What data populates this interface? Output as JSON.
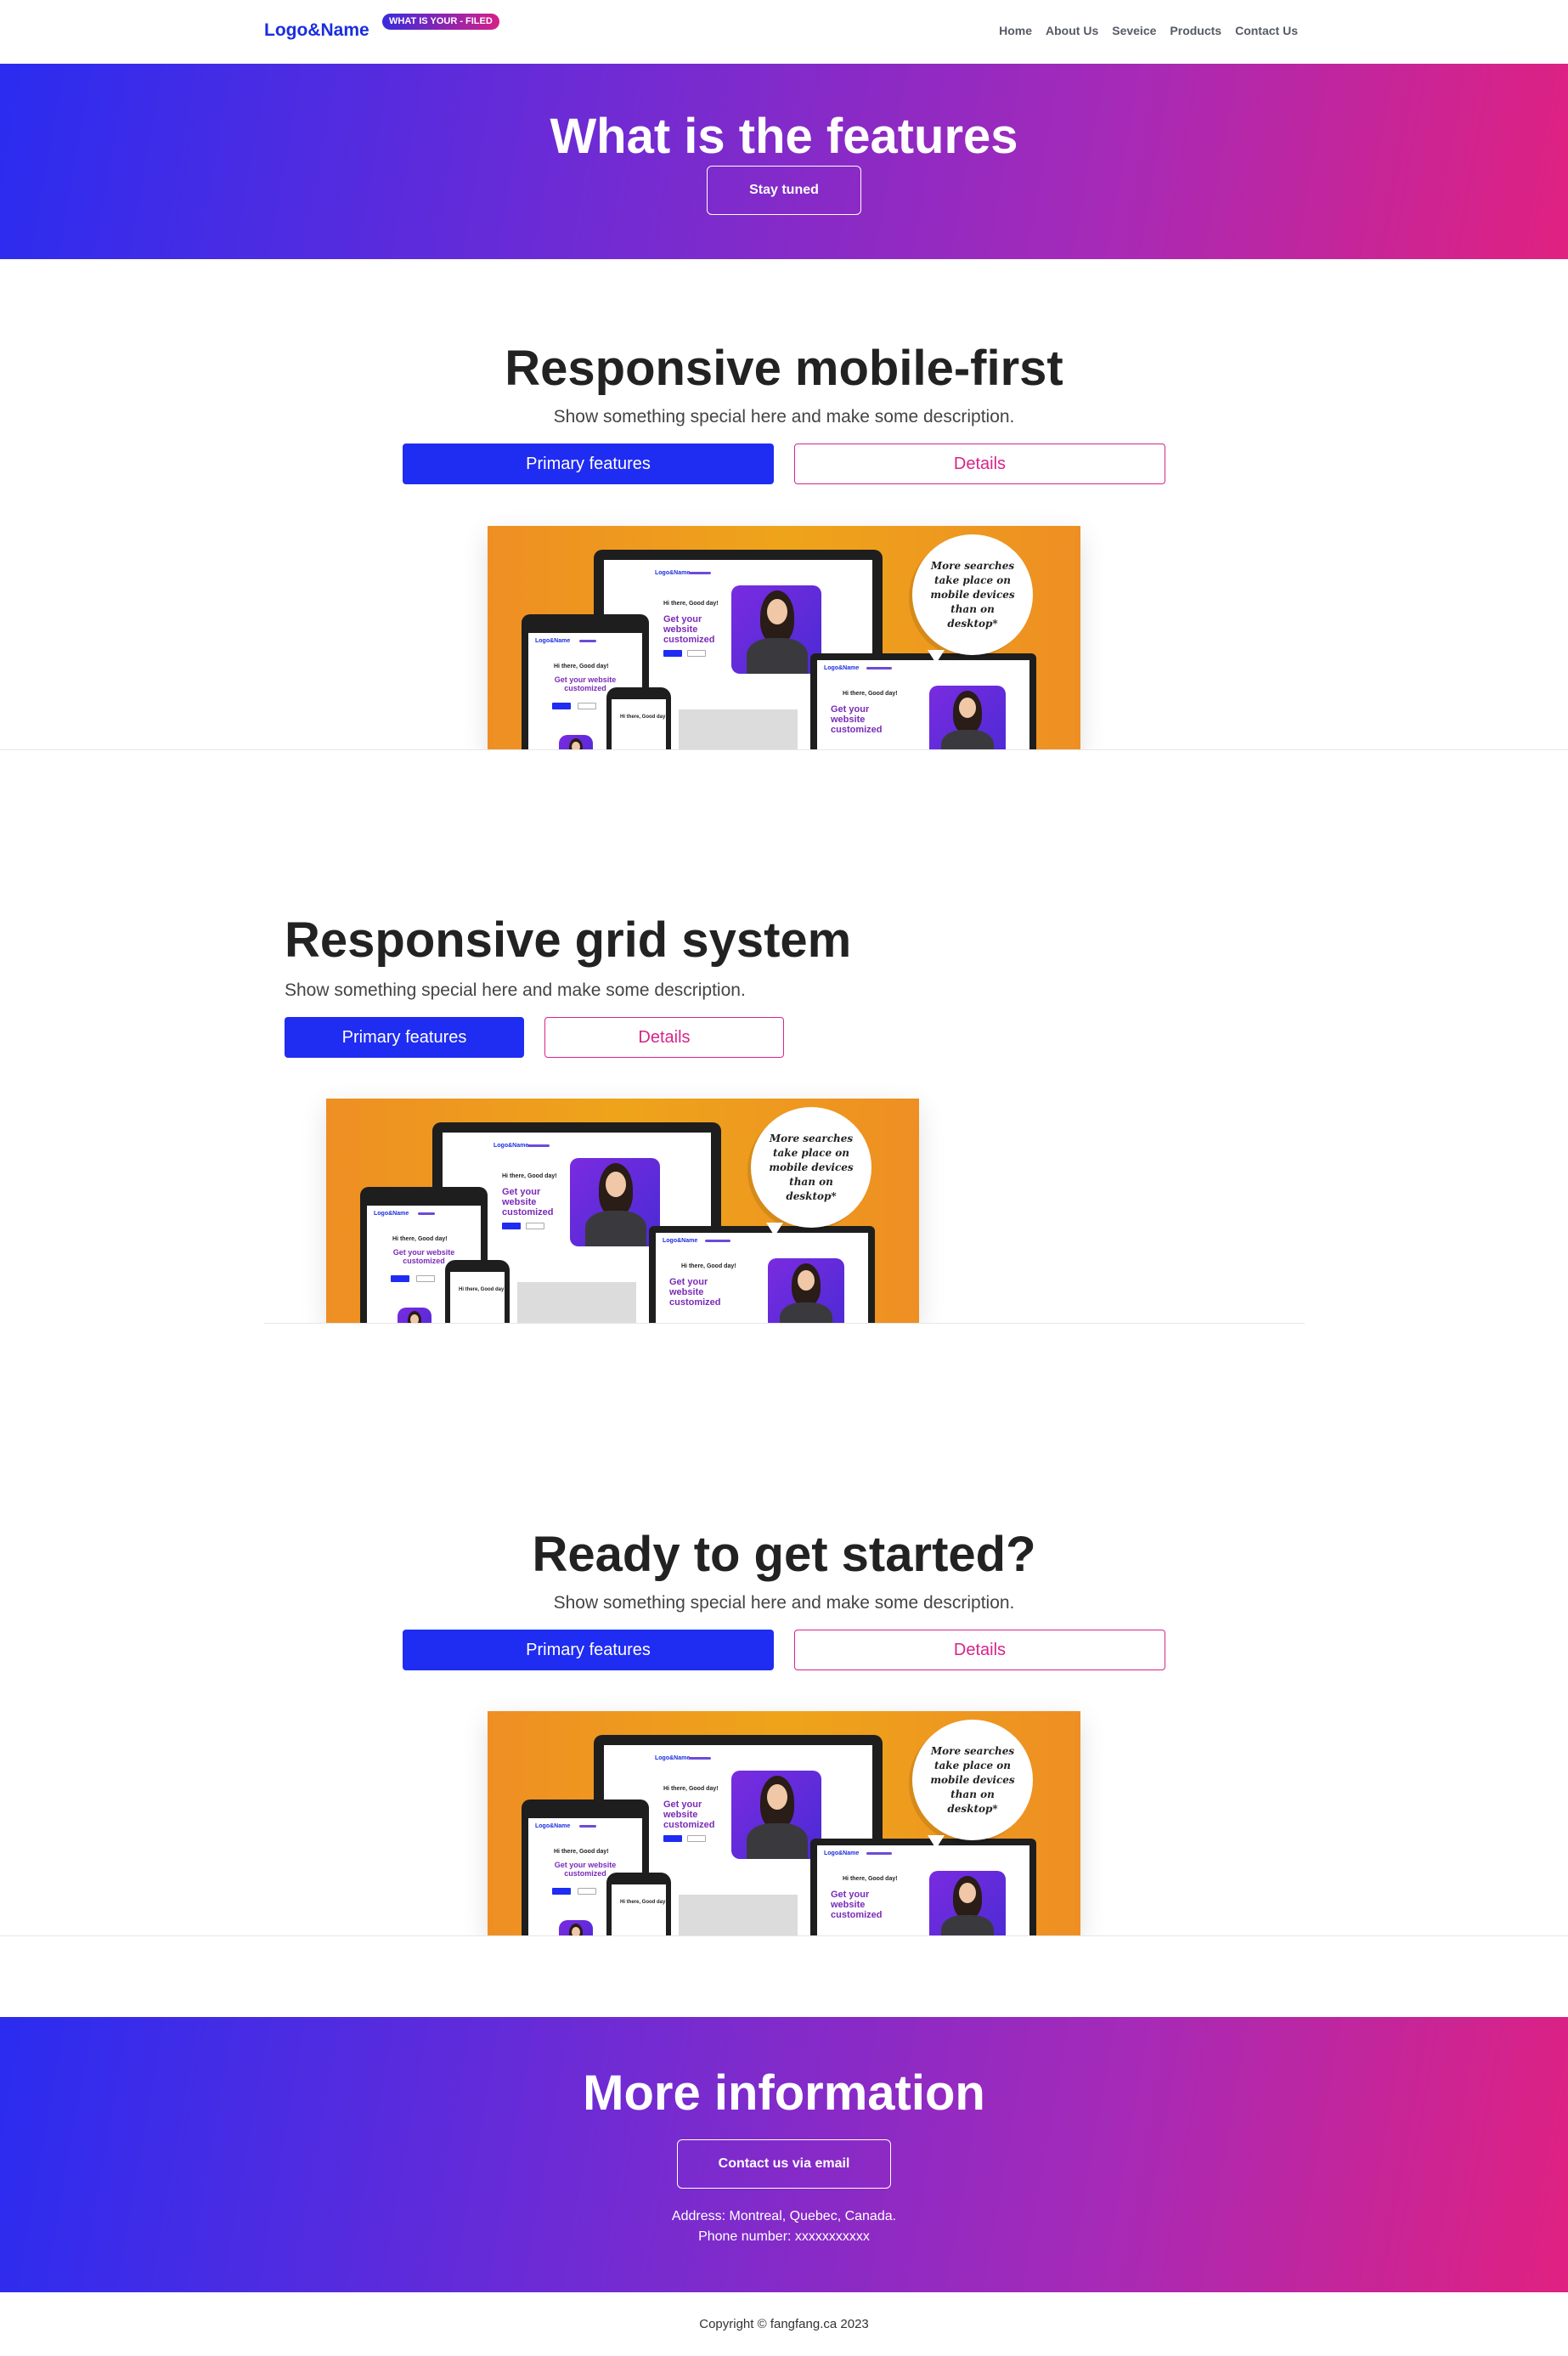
{
  "navbar": {
    "brand": "Logo&Name",
    "badge": "WHAT IS YOUR - FILED",
    "links": [
      "Home",
      "About Us",
      "Seveice",
      "Products",
      "Contact Us"
    ]
  },
  "hero": {
    "title": "What is the features",
    "button": "Stay tuned"
  },
  "sections": [
    {
      "title": "Responsive mobile-first",
      "description": "Show something special here and make some description.",
      "primary_button": "Primary features",
      "secondary_button": "Details"
    },
    {
      "title": "Responsive grid system",
      "description": "Show something special here and make some description.",
      "primary_button": "Primary features",
      "secondary_button": "Details"
    },
    {
      "title": "Ready to get started?",
      "description": "Show something special here and make some description.",
      "primary_button": "Primary features",
      "secondary_button": "Details"
    }
  ],
  "mockup": {
    "bubble_text": "More searches take place on mobile devices than on desktop*",
    "greeting": "Hi there, Good day!",
    "headline": "Get your website customized",
    "brand_mini": "Logo&Name"
  },
  "more_info": {
    "title": "More information",
    "button": "Contact us via email",
    "address": "Address: Montreal, Quebec, Canada.",
    "phone": "Phone number: xxxxxxxxxxx"
  },
  "footer": {
    "copyright": "Copyright © fangfang.ca 2023"
  },
  "colors": {
    "primary": "#1f2cf2",
    "accent_pink": "#d6258a",
    "gradient_start": "#2a2cf0",
    "gradient_end": "#e02180",
    "mockup_orange": "#ee9a1f"
  }
}
